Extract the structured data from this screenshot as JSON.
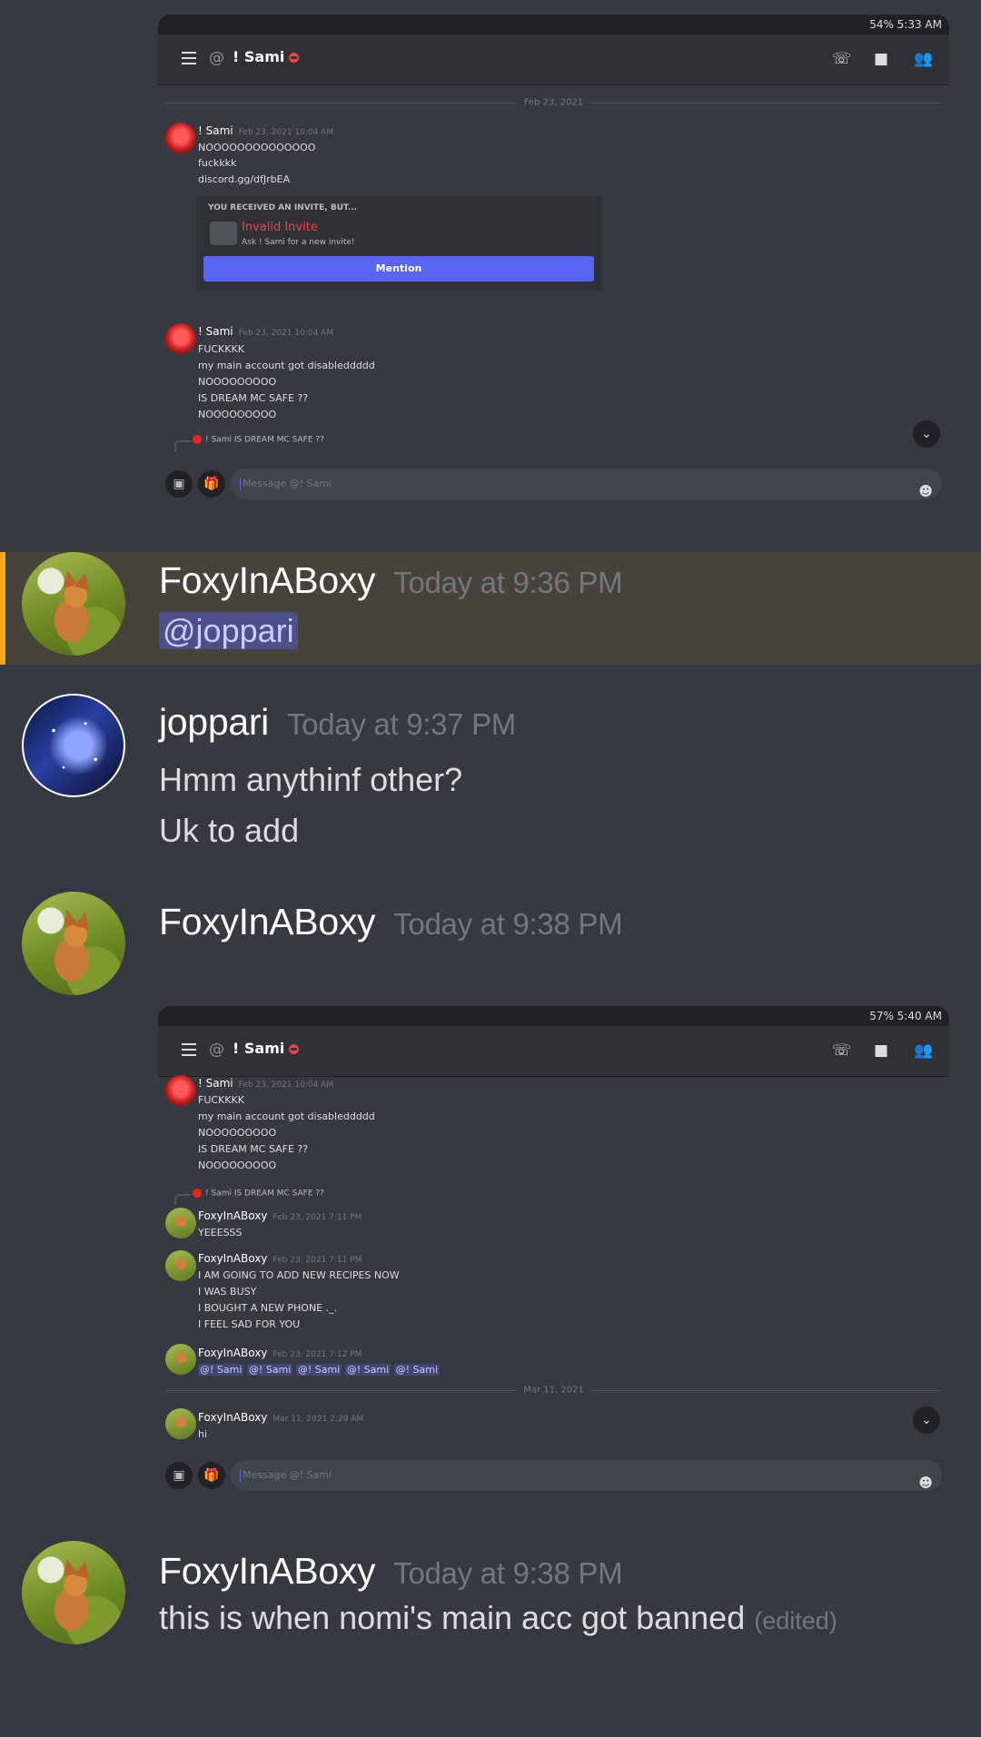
{
  "shot1": {
    "status_bar": "54% 5:33 AM",
    "header_at": "@",
    "header_title": "! Sami",
    "date_sep": "Feb 23, 2021",
    "msg1": {
      "author": "! Sami",
      "time": "Feb 23, 2021 10:04 AM",
      "lines": [
        "NOOOOOOOOOOOOOO",
        "fuckkkk",
        "discord.gg/dfJrbEA"
      ]
    },
    "embed": {
      "label": "YOU RECEIVED AN INVITE, BUT...",
      "title": "Invalid Invite",
      "subtitle": "Ask ! Sami for a new invite!",
      "button": "Mention"
    },
    "msg2": {
      "author": "! Sami",
      "time": "Feb 23, 2021 10:04 AM",
      "lines": [
        "FUCKKKK",
        "my main account got disableddddd",
        "NOOOOOOOOO",
        "IS DREAM MC SAFE ??",
        "NOOOOOOOOO"
      ]
    },
    "reply": "! Sami IS DREAM MC SAFE ??",
    "composer_placeholder": "Message @! Sami"
  },
  "main": {
    "msg1": {
      "author": "FoxyInABoxy",
      "time": "Today at 9:36 PM",
      "text": "@joppari"
    },
    "msg2": {
      "author": "joppari",
      "time": "Today at 9:37 PM",
      "line1": "Hmm anythinf other?",
      "line2": "Uk to add"
    },
    "msg3": {
      "author": "FoxyInABoxy",
      "time": "Today at 9:38 PM"
    },
    "msg4": {
      "author": "FoxyInABoxy",
      "time": "Today at 9:38 PM",
      "text": "this is when nomi's main acc got banned",
      "edited": "(edited)"
    }
  },
  "shot2": {
    "status_bar": "57% 5:40 AM",
    "header_at": "@",
    "header_title": "! Sami",
    "msg1": {
      "author": "! Sami",
      "time": "Feb 23, 2021 10:04 AM",
      "lines": [
        "FUCKKKK",
        "my main account got disableddddd",
        "NOOOOOOOOO",
        "IS DREAM MC SAFE ??",
        "NOOOOOOOOO"
      ]
    },
    "reply": "! Sami IS DREAM MC SAFE ??",
    "msg2": {
      "author": "FoxyInABoxy",
      "time": "Feb 23, 2021 7:11 PM",
      "lines": [
        "YEEESSS"
      ]
    },
    "msg3": {
      "author": "FoxyInABoxy",
      "time": "Feb 23, 2021 7:11 PM",
      "lines": [
        "I AM GOING TO ADD NEW RECIPES NOW",
        "I WAS BUSY",
        "I BOUGHT A NEW PHONE ._.",
        "I FEEL SAD FOR YOU"
      ]
    },
    "msg4": {
      "author": "FoxyInABoxy",
      "time": "Feb 23, 2021 7:12 PM",
      "mentions": [
        "@! Sami",
        "@! Sami",
        "@! Sami",
        "@! Sami",
        "@! Sami"
      ]
    },
    "date_sep": "Mar 11, 2021",
    "msg5": {
      "author": "FoxyInABoxy",
      "time": "Mar 11, 2021 2:29 AM",
      "lines": [
        "hi"
      ]
    },
    "composer_placeholder": "Message @! Sami"
  },
  "icons": [
    "hamburger-icon",
    "call-icon",
    "video-icon",
    "members-icon",
    "image-icon",
    "gift-icon",
    "emoji-icon",
    "chevron-down-icon"
  ]
}
